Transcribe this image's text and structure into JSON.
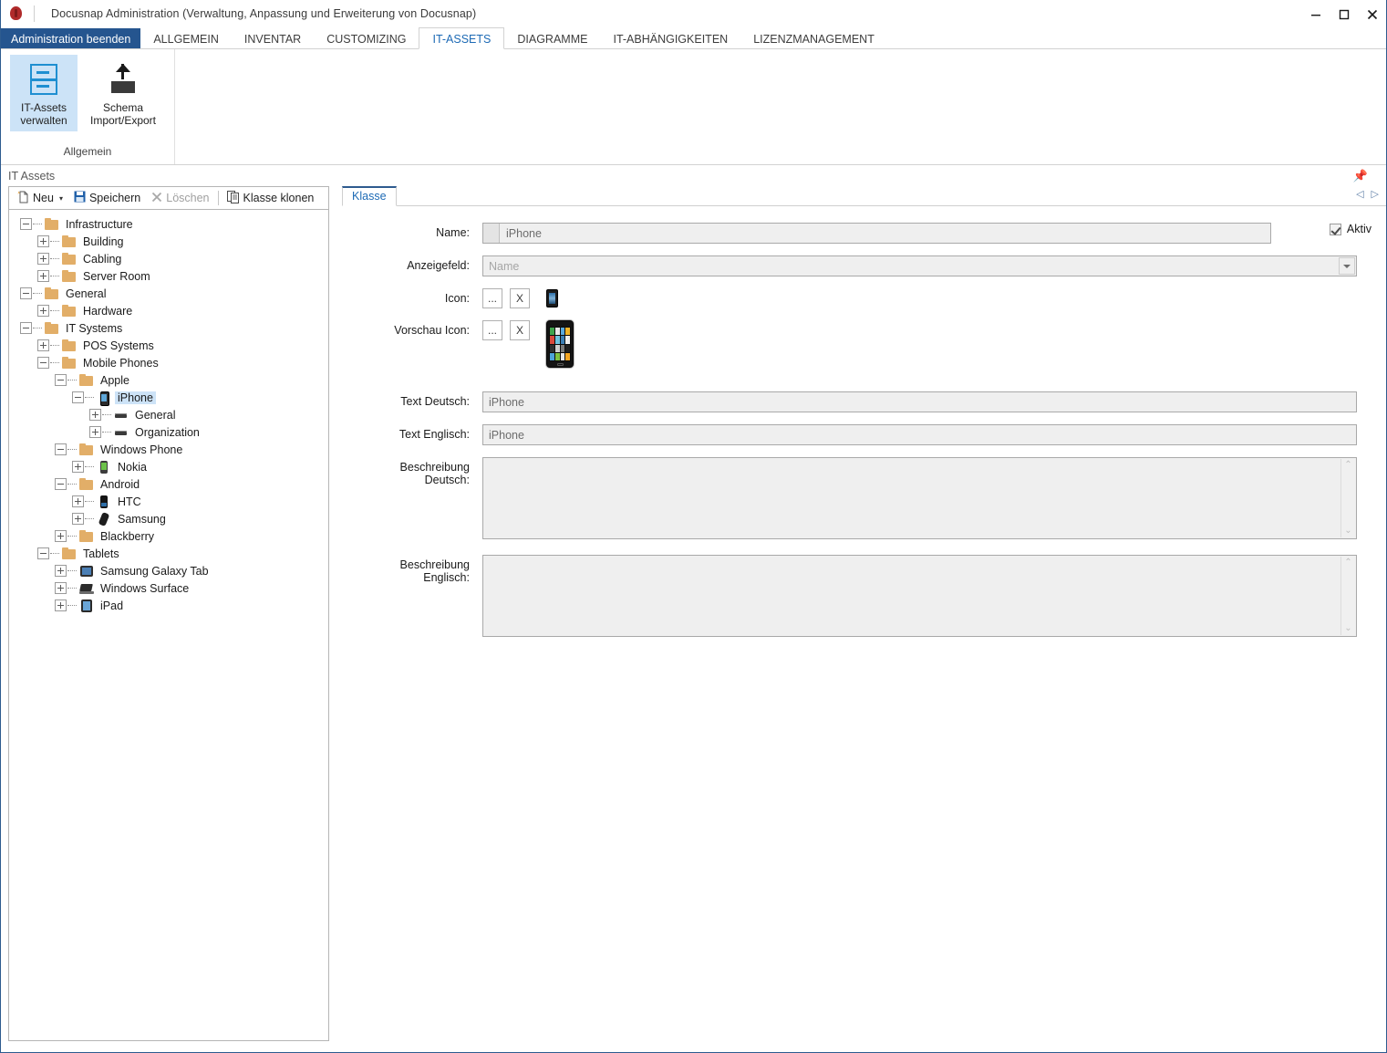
{
  "window": {
    "title": "Docusnap Administration (Verwaltung, Anpassung und Erweiterung von Docusnap)",
    "app_icon": "docusnap-bug-icon",
    "minimize": "–",
    "maximize": "❐",
    "close": "✕"
  },
  "ribbon": {
    "exit_tab": "Administration beenden",
    "tabs": [
      {
        "label": "ALLGEMEIN",
        "active": false
      },
      {
        "label": "INVENTAR",
        "active": false
      },
      {
        "label": "CUSTOMIZING",
        "active": false
      },
      {
        "label": "IT-ASSETS",
        "active": true
      },
      {
        "label": "DIAGRAMME",
        "active": false
      },
      {
        "label": "IT-ABHÄNGIGKEITEN",
        "active": false
      },
      {
        "label": "LIZENZMANAGEMENT",
        "active": false
      }
    ],
    "group_label": "Allgemein",
    "buttons": [
      {
        "line1": "IT-Assets",
        "line2": "verwalten",
        "icon": "cabinet-icon",
        "selected": true
      },
      {
        "line1": "Schema",
        "line2": "Import/Export",
        "icon": "export-arrow-icon",
        "selected": false
      }
    ]
  },
  "panel": {
    "title": "IT Assets",
    "pin_icon": "pin-icon"
  },
  "tree_toolbar": {
    "new": "Neu",
    "new_icon": "new-page-icon",
    "new_caret": "▾",
    "save": "Speichern",
    "save_icon": "floppy-disk-icon",
    "delete": "Löschen",
    "delete_icon": "x-icon",
    "clone": "Klasse klonen",
    "clone_icon": "clone-icon"
  },
  "tree": [
    {
      "label": "Infrastructure",
      "depth": 0,
      "icon": "folder",
      "state": "minus"
    },
    {
      "label": "Building",
      "depth": 1,
      "icon": "folder",
      "state": "plus"
    },
    {
      "label": "Cabling",
      "depth": 1,
      "icon": "folder",
      "state": "plus"
    },
    {
      "label": "Server Room",
      "depth": 1,
      "icon": "folder",
      "state": "plus"
    },
    {
      "label": "General",
      "depth": 0,
      "icon": "folder",
      "state": "minus"
    },
    {
      "label": "Hardware",
      "depth": 1,
      "icon": "folder",
      "state": "plus"
    },
    {
      "label": "IT Systems",
      "depth": 0,
      "icon": "folder",
      "state": "minus"
    },
    {
      "label": "POS Systems",
      "depth": 1,
      "icon": "folder",
      "state": "plus"
    },
    {
      "label": "Mobile Phones",
      "depth": 1,
      "icon": "folder",
      "state": "minus"
    },
    {
      "label": "Apple",
      "depth": 2,
      "icon": "folder",
      "state": "minus"
    },
    {
      "label": "iPhone",
      "depth": 3,
      "icon": "iphone",
      "state": "minus",
      "selected": true
    },
    {
      "label": "General",
      "depth": 4,
      "icon": "dash",
      "state": "plus"
    },
    {
      "label": "Organization",
      "depth": 4,
      "icon": "dash",
      "state": "plus"
    },
    {
      "label": "Windows Phone",
      "depth": 2,
      "icon": "folder",
      "state": "minus"
    },
    {
      "label": "Nokia",
      "depth": 3,
      "icon": "nokia",
      "state": "plus"
    },
    {
      "label": "Android",
      "depth": 2,
      "icon": "folder",
      "state": "minus"
    },
    {
      "label": "HTC",
      "depth": 3,
      "icon": "htc",
      "state": "plus"
    },
    {
      "label": "Samsung",
      "depth": 3,
      "icon": "samsung",
      "state": "plus"
    },
    {
      "label": "Blackberry",
      "depth": 2,
      "icon": "folder",
      "state": "plus"
    },
    {
      "label": "Tablets",
      "depth": 1,
      "icon": "folder",
      "state": "minus"
    },
    {
      "label": "Samsung Galaxy Tab",
      "depth": 2,
      "icon": "tablet",
      "state": "plus"
    },
    {
      "label": "Windows Surface",
      "depth": 2,
      "icon": "surface",
      "state": "plus"
    },
    {
      "label": "iPad",
      "depth": 2,
      "icon": "ipad",
      "state": "plus"
    }
  ],
  "document": {
    "tab": "Klasse",
    "nav_prev": "◁",
    "nav_next": "▷"
  },
  "form": {
    "name_label": "Name:",
    "name_value": "iPhone",
    "display_field_label": "Anzeigefeld:",
    "display_field_placeholder": "Name",
    "display_field_value": "",
    "icon_label": "Icon:",
    "icon_browse": "...",
    "icon_clear": "X",
    "icon_preview": "iphone-small-icon",
    "preview_icon_label": "Vorschau Icon:",
    "preview_browse": "...",
    "preview_clear": "X",
    "preview_image": "iphone-large-preview-icon",
    "text_de_label": "Text Deutsch:",
    "text_de_value": "iPhone",
    "text_en_label": "Text Englisch:",
    "text_en_value": "iPhone",
    "desc_de_label": "Beschreibung Deutsch:",
    "desc_de_value": "",
    "desc_en_label": "Beschreibung Englisch:",
    "desc_en_value": "",
    "active_label": "Aktiv",
    "active_checked": true,
    "scroll_up": "⌃",
    "scroll_down": "⌄"
  },
  "colors": {
    "accent_blue": "#25558f",
    "tab_active_blue": "#1d6ab5",
    "selection_blue": "#cde3f7",
    "folder_orange": "#e2ae68",
    "field_gray": "#efefef"
  }
}
